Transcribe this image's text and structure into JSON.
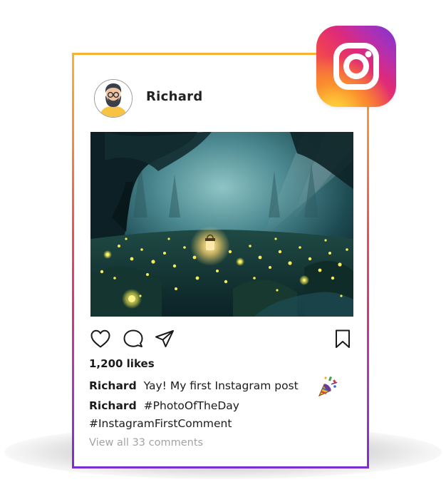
{
  "post": {
    "username": "Richard",
    "likes": "1,200 likes",
    "caption": {
      "user": "Richard",
      "text": "Yay! My first Instagram post"
    },
    "hashtag_comment": {
      "user": "Richard",
      "text": "#PhotoOfTheDay"
    },
    "hashtag_line": "#InstagramFirstComment",
    "view_comments": "View all 33 comments"
  },
  "icons": {
    "like": "heart-icon",
    "comment": "comment-bubble-icon",
    "share": "send-paper-plane-icon",
    "save": "bookmark-icon",
    "brand": "instagram-logo-icon",
    "emoji": "party-popper-icon"
  },
  "colors": {
    "frame_gradient": [
      "#f9b234",
      "#ee4a5c",
      "#d6357f",
      "#7b2fd0"
    ],
    "text": "#1b1b1b",
    "muted": "#a3a3a3",
    "firefly": "#f5e94a"
  }
}
